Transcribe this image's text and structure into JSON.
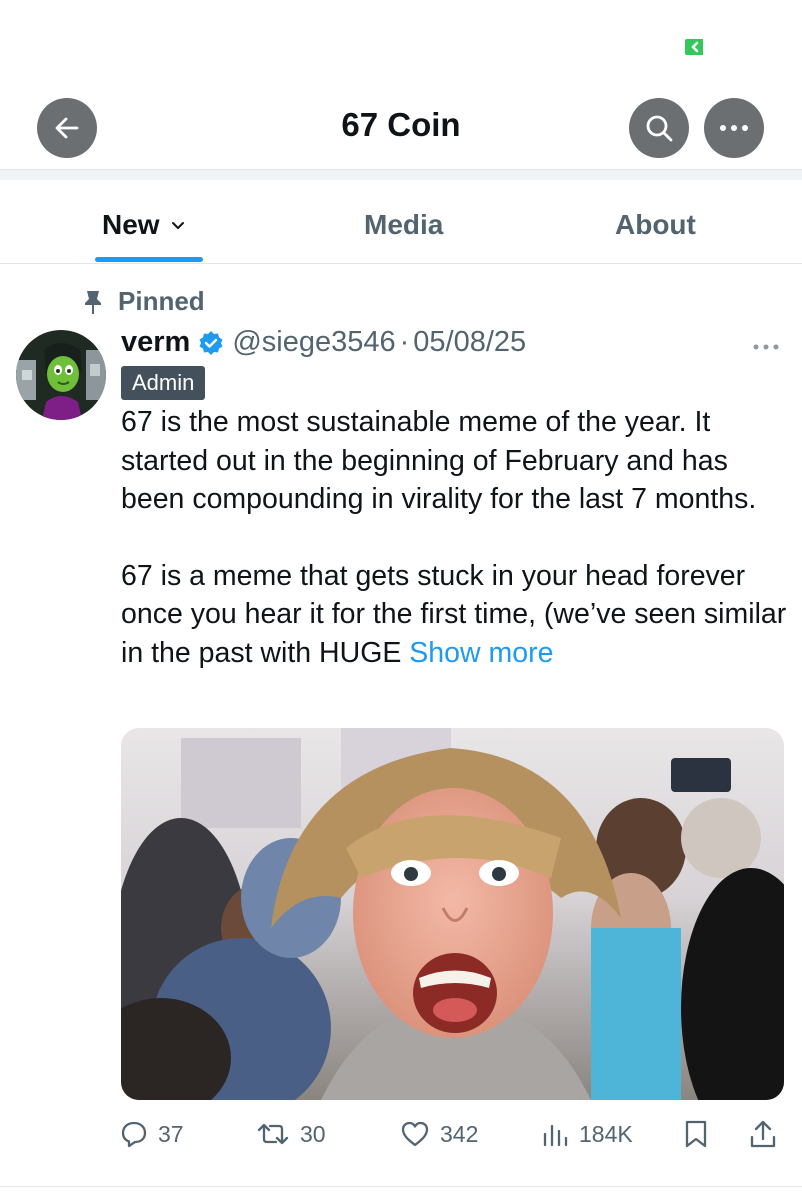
{
  "header": {
    "title": "67 Coin",
    "back_icon": "arrow-left-icon",
    "search_icon": "search-icon",
    "more_icon": "more-horizontal-icon"
  },
  "tabs": [
    {
      "label": "New",
      "selected": true,
      "icon": "chevron-down-icon"
    },
    {
      "label": "Media",
      "selected": false
    },
    {
      "label": "About",
      "selected": false
    }
  ],
  "post": {
    "pinned_label": "Pinned",
    "author": {
      "name": "verm",
      "handle": "@siege3546",
      "separator": "·",
      "date": "05/08/25",
      "verified": true,
      "badge": "Admin"
    },
    "text_p1": "67 is the most sustainable meme of the year. It started out in the beginning of February and has been compounding in virality for the last 7 months.",
    "text_p2": "67 is a meme that gets stuck in your head forever once you hear it for the first time, (we’ve seen similar in the past with HUGE",
    "show_more": "Show more",
    "actions": {
      "replies": "37",
      "reposts": "30",
      "likes": "342",
      "views": "184K"
    }
  },
  "colors": {
    "accent": "#1d9bf0",
    "muted": "#536471",
    "header_button": "#6b6f72",
    "status_green": "#34c759"
  }
}
